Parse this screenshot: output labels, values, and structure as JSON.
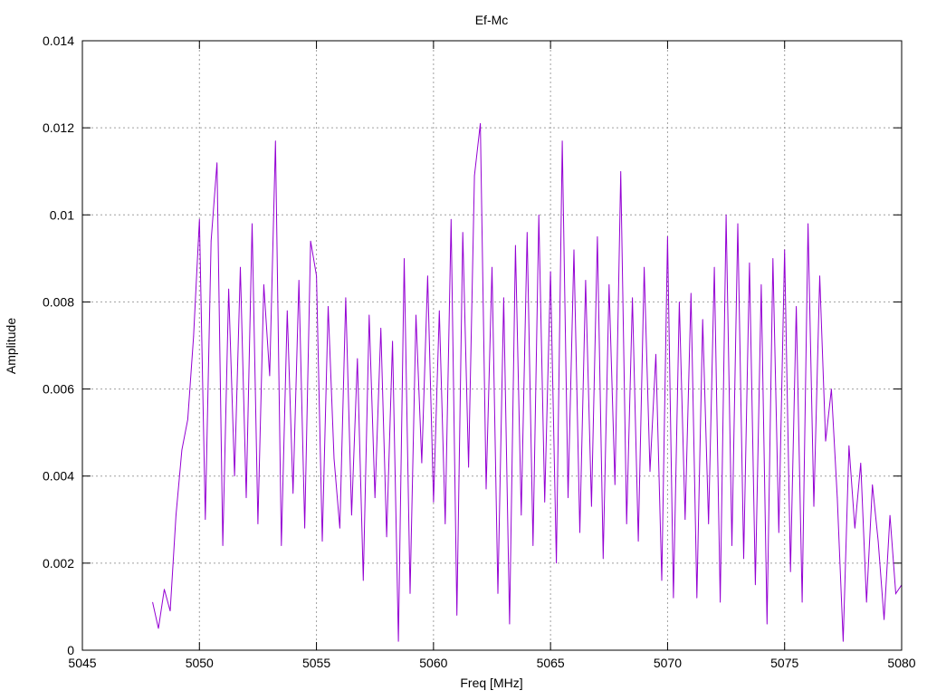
{
  "chart_data": {
    "type": "line",
    "title": "Ef-Mc",
    "xlabel": "Freq [MHz]",
    "ylabel": "Amplitude",
    "xlim": [
      5045,
      5080
    ],
    "ylim": [
      0,
      0.014
    ],
    "grid": true,
    "x_ticks": [
      "5045",
      "5050",
      "5055",
      "5060",
      "5065",
      "5070",
      "5075",
      "5080"
    ],
    "x_tick_values": [
      5045,
      5050,
      5055,
      5060,
      5065,
      5070,
      5075,
      5080
    ],
    "y_ticks": [
      "0",
      "0.002",
      "0.004",
      "0.006",
      "0.008",
      "0.01",
      "0.012",
      "0.014"
    ],
    "y_tick_values": [
      0,
      0.002,
      0.004,
      0.006,
      0.008,
      0.01,
      0.012,
      0.014
    ],
    "series": [
      {
        "name": "Ef-Mc",
        "color": "#9400d3",
        "x_start": 5048,
        "x_step": 0.25,
        "values": [
          0.0011,
          0.0005,
          0.0014,
          0.0009,
          0.0031,
          0.0046,
          0.0053,
          0.0072,
          0.0099,
          0.003,
          0.0094,
          0.0112,
          0.0024,
          0.0083,
          0.004,
          0.0088,
          0.0035,
          0.0098,
          0.0029,
          0.0084,
          0.0063,
          0.0117,
          0.0024,
          0.0078,
          0.0036,
          0.0085,
          0.0028,
          0.0094,
          0.0086,
          0.0025,
          0.0079,
          0.0044,
          0.0028,
          0.0081,
          0.0031,
          0.0067,
          0.0016,
          0.0077,
          0.0035,
          0.0074,
          0.0026,
          0.0071,
          0.0002,
          0.009,
          0.0013,
          0.0077,
          0.0043,
          0.0086,
          0.0034,
          0.0078,
          0.0029,
          0.0099,
          0.0008,
          0.0096,
          0.0042,
          0.0109,
          0.0121,
          0.0037,
          0.0088,
          0.0013,
          0.0081,
          0.0006,
          0.0093,
          0.0031,
          0.0096,
          0.0024,
          0.01,
          0.0034,
          0.0087,
          0.002,
          0.0117,
          0.0035,
          0.0092,
          0.0027,
          0.0085,
          0.0033,
          0.0095,
          0.0021,
          0.0084,
          0.0038,
          0.011,
          0.0029,
          0.0081,
          0.0025,
          0.0088,
          0.0041,
          0.0068,
          0.0016,
          0.0095,
          0.0012,
          0.008,
          0.003,
          0.0082,
          0.0012,
          0.0076,
          0.0029,
          0.0088,
          0.0011,
          0.01,
          0.0024,
          0.0098,
          0.0021,
          0.0089,
          0.0015,
          0.0084,
          0.0006,
          0.009,
          0.0027,
          0.0092,
          0.0018,
          0.0079,
          0.0011,
          0.0098,
          0.0033,
          0.0086,
          0.0048,
          0.006,
          0.0035,
          0.0002,
          0.0047,
          0.0028,
          0.0043,
          0.0011,
          0.0038,
          0.0025,
          0.0007,
          0.0031,
          0.0013,
          0.0015
        ]
      }
    ]
  }
}
